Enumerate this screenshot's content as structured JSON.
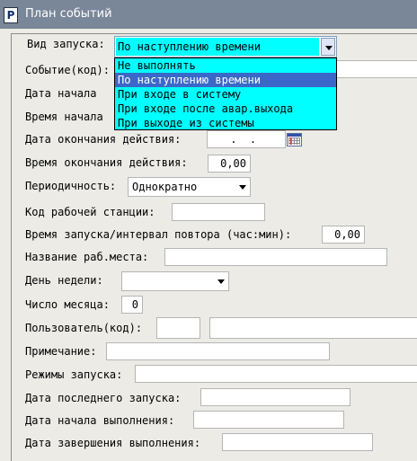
{
  "window": {
    "title": "План событий",
    "icon_glyph": "P"
  },
  "form": {
    "launch_type": {
      "label": "Вид запуска:",
      "value": "По наступлению времени"
    },
    "event_code": {
      "label": "Событие(код):"
    },
    "start_date": {
      "label": "Дата  начала"
    },
    "start_time": {
      "label": "Время начала"
    },
    "end_date": {
      "label": "Дата  окончания действия:",
      "value": " .  . "
    },
    "end_time": {
      "label": "Время окончания действия:",
      "value": "0,00"
    },
    "periodicity": {
      "label": "Периодичность:",
      "value": "Однократно"
    },
    "workstation_code": {
      "label": "Код рабочей станции:"
    },
    "interval": {
      "label": "Время запуска/интервал повтора (час:мин):",
      "value": "0,00"
    },
    "workplace_name": {
      "label": "Название раб.места:"
    },
    "weekday": {
      "label": "День  недели:"
    },
    "month_day": {
      "label": "Число месяца:",
      "value": "0"
    },
    "user_code": {
      "label": "Пользователь(код):"
    },
    "note": {
      "label": "Примечание:"
    },
    "launch_modes": {
      "label": "Режимы запуска:"
    },
    "last_launch": {
      "label": "Дата последнего запуска:"
    },
    "exec_start": {
      "label": "Дата начала выполнения:"
    },
    "exec_end": {
      "label": "Дата завершения выполнения:"
    }
  },
  "dropdown_options": [
    "Не выполнять",
    "По наступлению времени",
    "При входе в систему",
    "При входе после авар.выхода",
    "При выходе из системы"
  ],
  "colors": {
    "selection": "#00ffff",
    "highlight": "#3b68c8",
    "titlebar": "#7a8799"
  }
}
